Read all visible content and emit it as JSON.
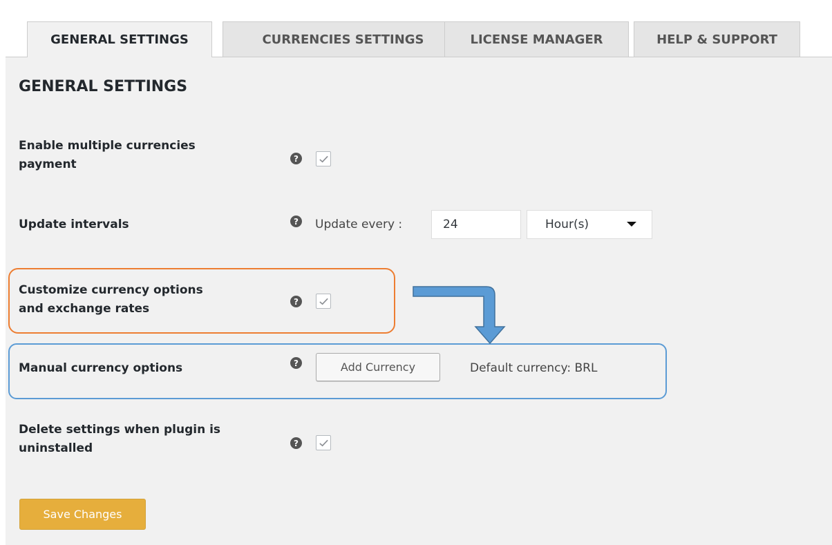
{
  "tabs": [
    {
      "label": "GENERAL SETTINGS",
      "active": true
    },
    {
      "label": "CURRENCIES SETTINGS",
      "active": false
    },
    {
      "label": "LICENSE MANAGER",
      "active": false
    },
    {
      "label": "HELP & SUPPORT",
      "active": false
    }
  ],
  "page_title": "GENERAL SETTINGS",
  "settings": {
    "multi_currency": {
      "label_line1": "Enable multiple currencies",
      "label_line2": "payment",
      "checked": true
    },
    "update_intervals": {
      "label": "Update intervals",
      "prefix": "Update every :",
      "value": "24",
      "unit_selected": "Hour(s)"
    },
    "customize": {
      "label_line1": "Customize currency options",
      "label_line2": "and exchange rates",
      "checked": true
    },
    "manual": {
      "label": "Manual currency options",
      "add_button": "Add Currency",
      "default_currency": "Default currency: BRL"
    },
    "delete_settings": {
      "label_line1": "Delete settings when plugin is",
      "label_line2": "uninstalled",
      "checked": true
    }
  },
  "save_button": "Save Changes",
  "icons": {
    "help": "help-icon",
    "check": "checkmark-icon",
    "arrow": "bent-arrow-down-icon"
  },
  "colors": {
    "background": "#f1f1f1",
    "save_button": "#e6ae3c",
    "orange_highlight": "#ed7d31",
    "blue_highlight": "#5b9bd5",
    "arrow_fill": "#5b9bd5"
  }
}
